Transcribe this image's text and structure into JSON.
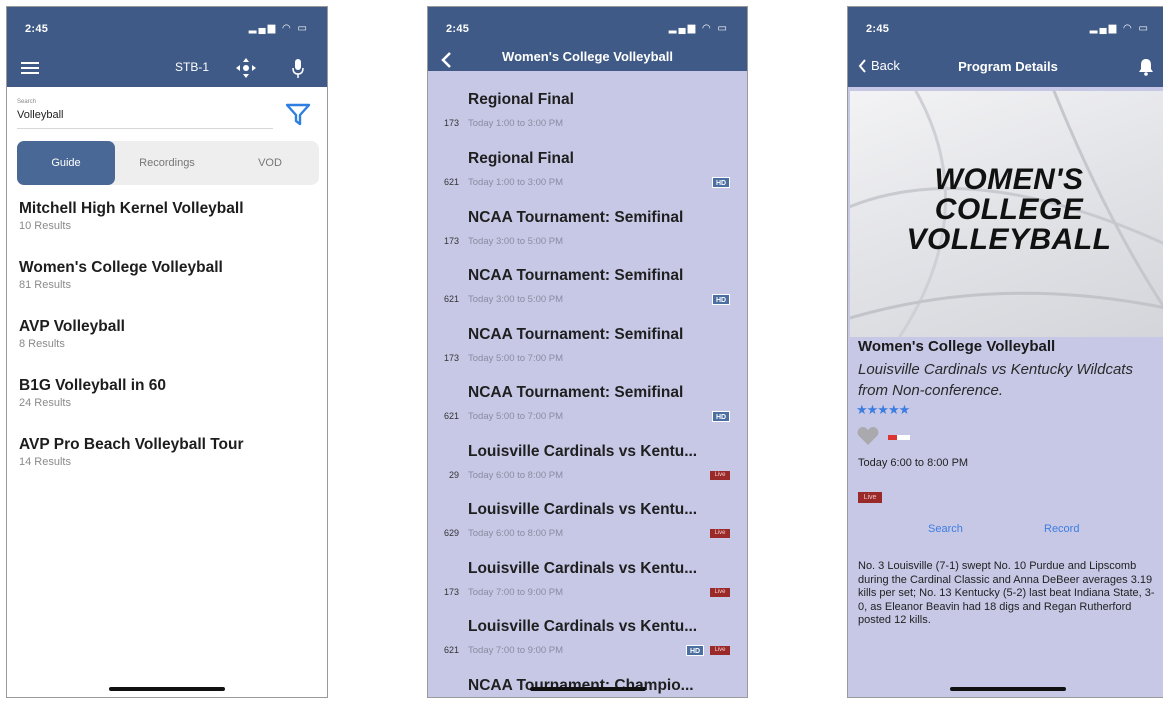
{
  "status": {
    "time": "2:45",
    "signal": "▂▄▆ ◠ ▭"
  },
  "search_screen": {
    "stb": "STB-1",
    "search_label": "Search",
    "search_value": "Volleyball",
    "tabs": [
      "Guide",
      "Recordings",
      "VOD"
    ],
    "active_tab": "Guide",
    "results": [
      {
        "title": "Mitchell High Kernel Volleyball",
        "count": "10 Results"
      },
      {
        "title": "Women's College Volleyball",
        "count": "81 Results"
      },
      {
        "title": "AVP Volleyball",
        "count": "8 Results"
      },
      {
        "title": "B1G Volleyball in 60",
        "count": "24 Results"
      },
      {
        "title": "AVP Pro Beach Volleyball Tour",
        "count": "14 Results"
      }
    ]
  },
  "list_screen": {
    "title": "Women's College Volleyball",
    "hd_label": "HD",
    "live_label": "Live",
    "items": [
      {
        "title": "Regional Final",
        "channel": "173",
        "time": "Today 1:00 to 3:00 PM",
        "hd": false,
        "live": false
      },
      {
        "title": "Regional Final",
        "channel": "621",
        "time": "Today 1:00 to 3:00 PM",
        "hd": true,
        "live": false
      },
      {
        "title": "NCAA Tournament: Semifinal",
        "channel": "173",
        "time": "Today 3:00 to 5:00 PM",
        "hd": false,
        "live": false
      },
      {
        "title": "NCAA Tournament: Semifinal",
        "channel": "621",
        "time": "Today 3:00 to 5:00 PM",
        "hd": true,
        "live": false
      },
      {
        "title": "NCAA Tournament: Semifinal",
        "channel": "173",
        "time": "Today 5:00 to 7:00 PM",
        "hd": false,
        "live": false
      },
      {
        "title": "NCAA Tournament: Semifinal",
        "channel": "621",
        "time": "Today 5:00 to 7:00 PM",
        "hd": true,
        "live": false
      },
      {
        "title": "Louisville Cardinals vs Kentu...",
        "channel": "29",
        "time": "Today 6:00 to 8:00 PM",
        "hd": false,
        "live": true
      },
      {
        "title": "Louisville Cardinals vs Kentu...",
        "channel": "629",
        "time": "Today 6:00 to 8:00 PM",
        "hd": false,
        "live": true
      },
      {
        "title": "Louisville Cardinals vs Kentu...",
        "channel": "173",
        "time": "Today 7:00 to 9:00 PM",
        "hd": false,
        "live": true
      },
      {
        "title": "Louisville Cardinals vs Kentu...",
        "channel": "621",
        "time": "Today 7:00 to 9:00 PM",
        "hd": true,
        "live": true
      },
      {
        "title": "NCAA Tournament: Champio...",
        "channel": "",
        "time": "",
        "hd": false,
        "live": false
      }
    ]
  },
  "detail_screen": {
    "back_label": "Back",
    "title": "Program Details",
    "hero_text": "WOMEN'S COLLEGE VOLLEYBALL",
    "program_title": "Women's College Volleyball",
    "subtitle": "Louisville Cardinals vs Kentucky Wildcats from Non-conference.",
    "stars": "★★★★★",
    "time": "Today 6:00 to 8:00 PM",
    "live_label": "Live",
    "search_action": "Search",
    "record_action": "Record",
    "description": "No. 3 Louisville (7-1) swept No. 10 Purdue and Lipscomb during the Cardinal Classic and Anna DeBeer averages 3.19 kills per set; No. 13 Kentucky (5-2) last beat Indiana State, 3-0, as Eleanor Beavin had 18 digs and Regan Rutherford posted 12 kills."
  },
  "colors": {
    "nav_bar": "#3f5a86",
    "list_bg": "#c6c8e6",
    "accent": "#3f7de0",
    "live": "#9a2a2a"
  }
}
